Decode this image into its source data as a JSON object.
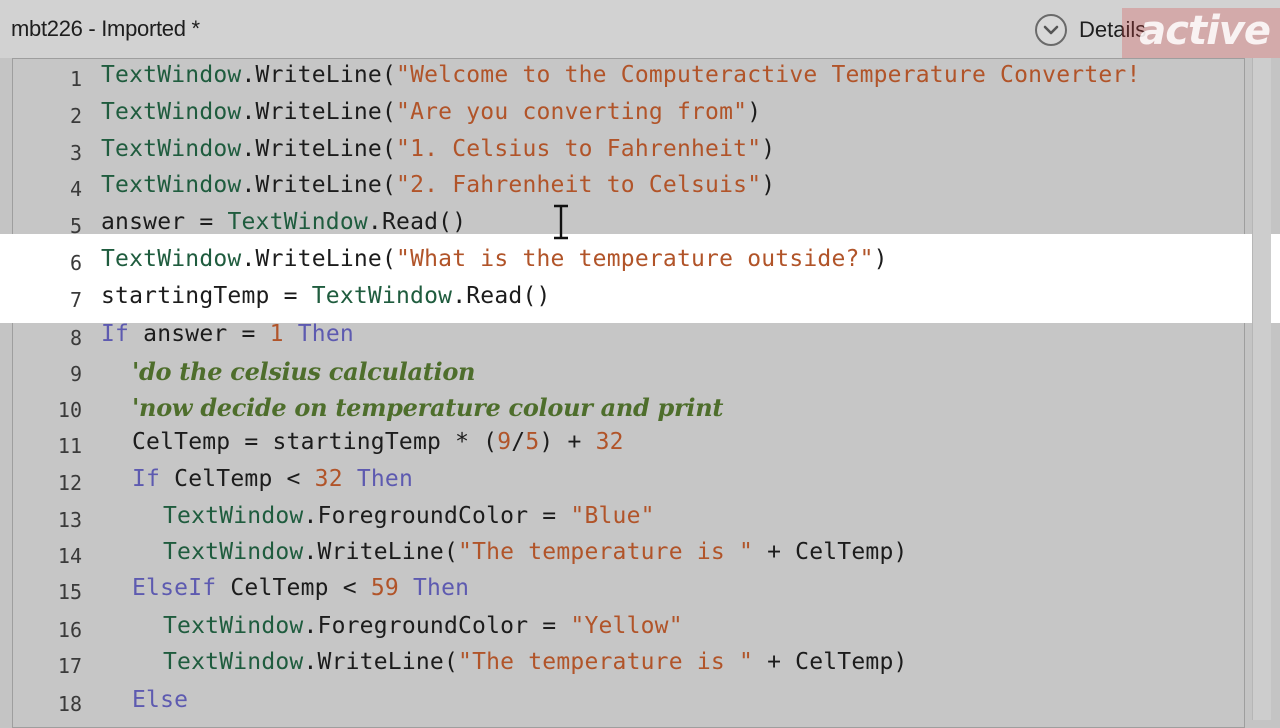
{
  "window": {
    "title": "mbt226 - Imported *",
    "details_label": "Details",
    "watermark": "active"
  },
  "editor": {
    "lines": [
      {
        "num": "1",
        "indent": 0,
        "tokens": [
          {
            "t": "obj",
            "v": "TextWindow"
          },
          {
            "t": "id",
            "v": ".WriteLine("
          },
          {
            "t": "str",
            "v": "\"Welcome to the Computeractive Temperature Converter!"
          }
        ]
      },
      {
        "num": "2",
        "indent": 0,
        "tokens": [
          {
            "t": "obj",
            "v": "TextWindow"
          },
          {
            "t": "id",
            "v": ".WriteLine("
          },
          {
            "t": "str",
            "v": "\"Are you converting from\""
          },
          {
            "t": "id",
            "v": ")"
          }
        ]
      },
      {
        "num": "3",
        "indent": 0,
        "tokens": [
          {
            "t": "obj",
            "v": "TextWindow"
          },
          {
            "t": "id",
            "v": ".WriteLine("
          },
          {
            "t": "str",
            "v": "\"1. Celsius to Fahrenheit\""
          },
          {
            "t": "id",
            "v": ")"
          }
        ]
      },
      {
        "num": "4",
        "indent": 0,
        "tokens": [
          {
            "t": "obj",
            "v": "TextWindow"
          },
          {
            "t": "id",
            "v": ".WriteLine("
          },
          {
            "t": "str",
            "v": "\"2. Fahrenheit to Celsuis\""
          },
          {
            "t": "id",
            "v": ")"
          }
        ]
      },
      {
        "num": "5",
        "indent": 0,
        "tokens": [
          {
            "t": "id",
            "v": "answer = "
          },
          {
            "t": "obj",
            "v": "TextWindow"
          },
          {
            "t": "id",
            "v": ".Read()"
          }
        ]
      },
      {
        "num": "6",
        "indent": 0,
        "tokens": [
          {
            "t": "obj",
            "v": "TextWindow"
          },
          {
            "t": "id",
            "v": ".WriteLine("
          },
          {
            "t": "str",
            "v": "\"What is the temperature outside?\""
          },
          {
            "t": "id",
            "v": ")"
          }
        ]
      },
      {
        "num": "7",
        "indent": 0,
        "tokens": [
          {
            "t": "id",
            "v": "startingTemp = "
          },
          {
            "t": "obj",
            "v": "TextWindow"
          },
          {
            "t": "id",
            "v": ".Read()"
          }
        ]
      },
      {
        "num": "8",
        "indent": 0,
        "tokens": [
          {
            "t": "kw",
            "v": "If"
          },
          {
            "t": "id",
            "v": " answer = "
          },
          {
            "t": "num",
            "v": "1"
          },
          {
            "t": "id",
            "v": " "
          },
          {
            "t": "kw",
            "v": "Then"
          }
        ]
      },
      {
        "num": "9",
        "indent": 1,
        "comment": true,
        "tokens": [
          {
            "t": "com",
            "v": "'do the celsius calculation"
          }
        ]
      },
      {
        "num": "10",
        "indent": 1,
        "comment": true,
        "tokens": [
          {
            "t": "com",
            "v": "'now decide on temperature colour and print"
          }
        ]
      },
      {
        "num": "11",
        "indent": 1,
        "tokens": [
          {
            "t": "id",
            "v": "CelTemp = startingTemp * ("
          },
          {
            "t": "num",
            "v": "9"
          },
          {
            "t": "id",
            "v": "/"
          },
          {
            "t": "num",
            "v": "5"
          },
          {
            "t": "id",
            "v": ") + "
          },
          {
            "t": "num",
            "v": "32"
          }
        ]
      },
      {
        "num": "12",
        "indent": 1,
        "tokens": [
          {
            "t": "kw",
            "v": "If"
          },
          {
            "t": "id",
            "v": " CelTemp < "
          },
          {
            "t": "num",
            "v": "32"
          },
          {
            "t": "id",
            "v": " "
          },
          {
            "t": "kw",
            "v": "Then"
          }
        ]
      },
      {
        "num": "13",
        "indent": 2,
        "tokens": [
          {
            "t": "obj",
            "v": "TextWindow"
          },
          {
            "t": "id",
            "v": ".ForegroundColor = "
          },
          {
            "t": "str",
            "v": "\"Blue\""
          }
        ]
      },
      {
        "num": "14",
        "indent": 2,
        "tokens": [
          {
            "t": "obj",
            "v": "TextWindow"
          },
          {
            "t": "id",
            "v": ".WriteLine("
          },
          {
            "t": "str",
            "v": "\"The temperature is \""
          },
          {
            "t": "id",
            "v": " + CelTemp)"
          }
        ]
      },
      {
        "num": "15",
        "indent": 1,
        "tokens": [
          {
            "t": "kw",
            "v": "ElseIf"
          },
          {
            "t": "id",
            "v": " CelTemp < "
          },
          {
            "t": "num",
            "v": "59"
          },
          {
            "t": "id",
            "v": " "
          },
          {
            "t": "kw",
            "v": "Then"
          }
        ]
      },
      {
        "num": "16",
        "indent": 2,
        "tokens": [
          {
            "t": "obj",
            "v": "TextWindow"
          },
          {
            "t": "id",
            "v": ".ForegroundColor = "
          },
          {
            "t": "str",
            "v": "\"Yellow\""
          }
        ]
      },
      {
        "num": "17",
        "indent": 2,
        "tokens": [
          {
            "t": "obj",
            "v": "TextWindow"
          },
          {
            "t": "id",
            "v": ".WriteLine("
          },
          {
            "t": "str",
            "v": "\"The temperature is \""
          },
          {
            "t": "id",
            "v": " + CelTemp)"
          }
        ]
      },
      {
        "num": "18",
        "indent": 1,
        "tokens": [
          {
            "t": "kw",
            "v": "Else"
          }
        ]
      }
    ],
    "highlighted_lines": [
      "6",
      "7"
    ]
  },
  "colors": {
    "keyword": "#5d5ab0",
    "string": "#b15429",
    "object": "#1f5c3e",
    "comment": "#4e6e2c",
    "highlight": "#ffffff",
    "background": "#c6c6c6"
  },
  "icons": {
    "details": "chevron-down-icon",
    "cursor": "text-cursor-icon"
  }
}
